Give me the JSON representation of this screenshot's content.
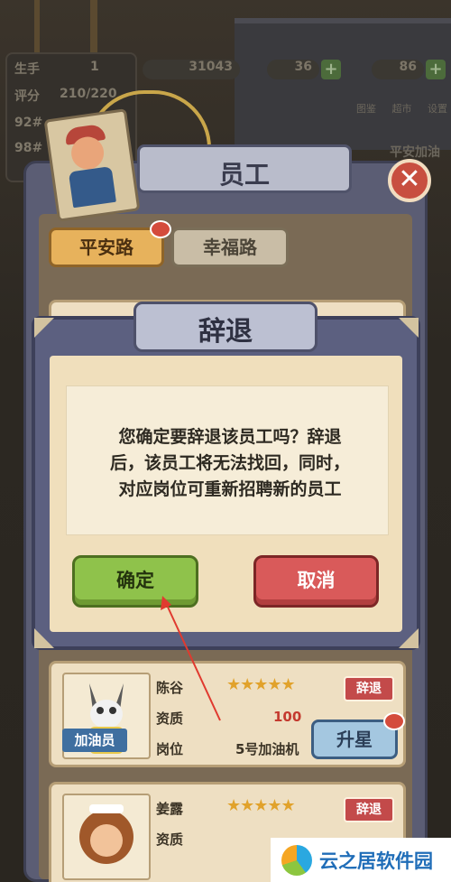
{
  "hud": {
    "rank_label": "生手",
    "rank_value": "1",
    "score_label": "评分",
    "score_value": "210/220",
    "cash": "31043",
    "gems": "36",
    "energy": "86",
    "hidden_row1": "92#",
    "hidden_row2": "98#",
    "top_icon_labels": [
      "图鉴",
      "超市",
      "设置"
    ],
    "station_name": "平安加油"
  },
  "employee_panel": {
    "title": "员工",
    "tabs": [
      {
        "label": "平安路",
        "active": true,
        "has_dot": true
      },
      {
        "label": "幸福路",
        "active": false,
        "has_dot": false
      }
    ],
    "employees": [
      {
        "name": "陈谷",
        "stars": "★★★★★",
        "quality_label": "资质",
        "quality_value": "100",
        "position_label": "岗位",
        "position_value": "5号加油机",
        "role": "加油员",
        "dismiss_label": "辞退",
        "upgrade_label": "升星"
      },
      {
        "name": "姜露",
        "stars": "★★★★★",
        "quality_label": "资质",
        "dismiss_label": "辞退"
      }
    ]
  },
  "dialog": {
    "title": "辞退",
    "message_lines": [
      "您确定要辞退该员工吗？辞退",
      "后，该员工将无法找回，同时，",
      "对应岗位可重新招聘新的员工"
    ],
    "confirm_label": "确定",
    "cancel_label": "取消"
  },
  "watermark": {
    "text": "云之居软件园"
  },
  "colors": {
    "confirm_green": "#8fc24b",
    "cancel_red": "#d95a5a",
    "arrow_red": "#e03a2f",
    "panel_slate": "#5c6080"
  }
}
